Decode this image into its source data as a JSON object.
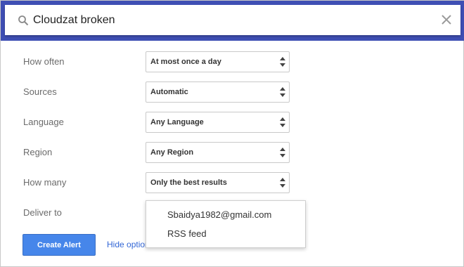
{
  "search": {
    "value": "Cloudzat broken",
    "icon": "search-icon",
    "clear_icon": "close-icon"
  },
  "options": [
    {
      "label": "How often",
      "value": "At most once a day"
    },
    {
      "label": "Sources",
      "value": "Automatic"
    },
    {
      "label": "Language",
      "value": "Any Language"
    },
    {
      "label": "Region",
      "value": "Any Region"
    },
    {
      "label": "How many",
      "value": "Only the best results"
    }
  ],
  "deliver": {
    "label": "Deliver to",
    "menu_items": [
      "Sbaidya1982@gmail.com",
      "RSS feed"
    ]
  },
  "actions": {
    "create_label": "Create Alert",
    "hide_options_label": "Hide options"
  },
  "colors": {
    "header_bg": "#3f4fb4",
    "button_bg": "#4686ea",
    "link": "#3367d6"
  }
}
